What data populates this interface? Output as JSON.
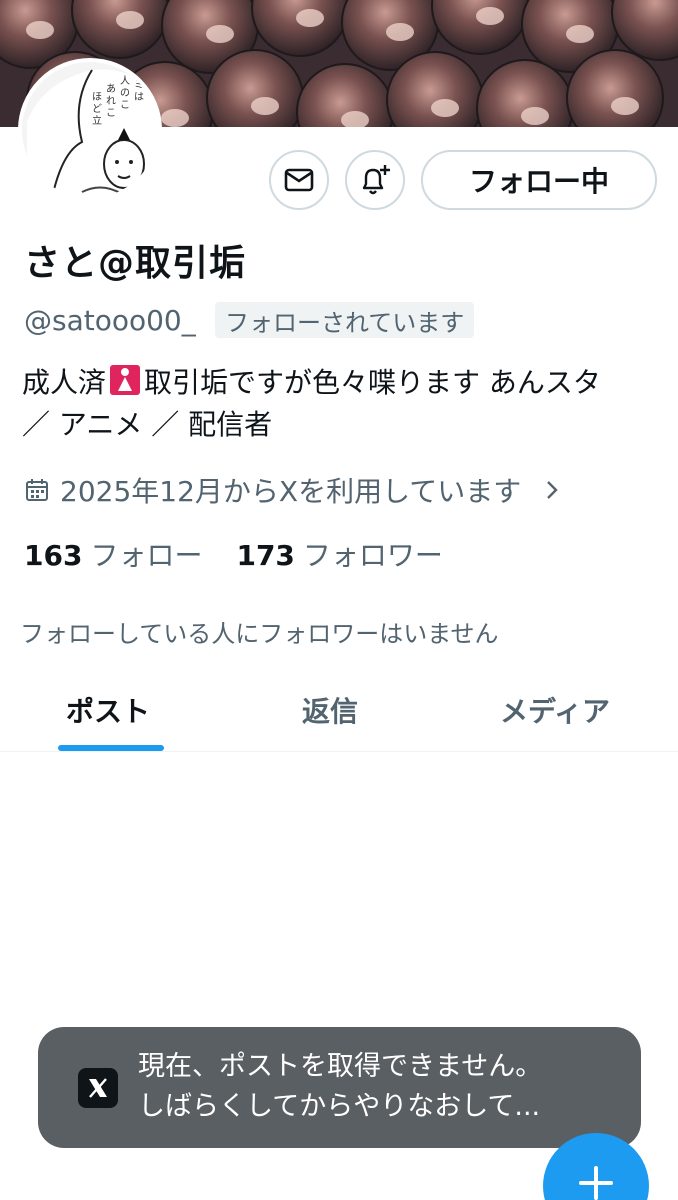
{
  "profile": {
    "display_name": "さと@取引垢",
    "handle": "@satooo00_",
    "follows_you": "フォローされています",
    "bio_line1_a": "成人済",
    "bio_line1_b": "取引垢ですが色々喋ります あんスタ",
    "bio_line2": "／ アニメ ／ 配信者",
    "joined": "2025年12月からXを利用しています",
    "following_count": "163",
    "following_label": "フォロー",
    "followers_count": "173",
    "followers_label": "フォロワー",
    "known_followers": "フォローしている人にフォロワーはいません",
    "avatar_text": "キミは、人のことをあれこれ言えるほど立派じゃないだろう。"
  },
  "actions": {
    "follow_label": "フォロー中"
  },
  "tabs": [
    {
      "label": "ポスト",
      "active": true
    },
    {
      "label": "返信",
      "active": false
    },
    {
      "label": "メディア",
      "active": false
    }
  ],
  "toast": {
    "line1": "現在、ポストを取得できません。",
    "line2": "しばらくしてからやりなおして..."
  },
  "icons": {
    "message": "envelope-icon",
    "notifications": "bell-plus-icon",
    "calendar": "calendar-icon",
    "chevron": "chevron-right-icon",
    "toast_logo": "x-logo-icon",
    "compose": "plus-icon"
  },
  "colors": {
    "accent": "#1d9bf0",
    "text": "#0f1419",
    "secondary": "#536471",
    "border": "#cfd9de",
    "toast_bg": "#5a5f63"
  }
}
